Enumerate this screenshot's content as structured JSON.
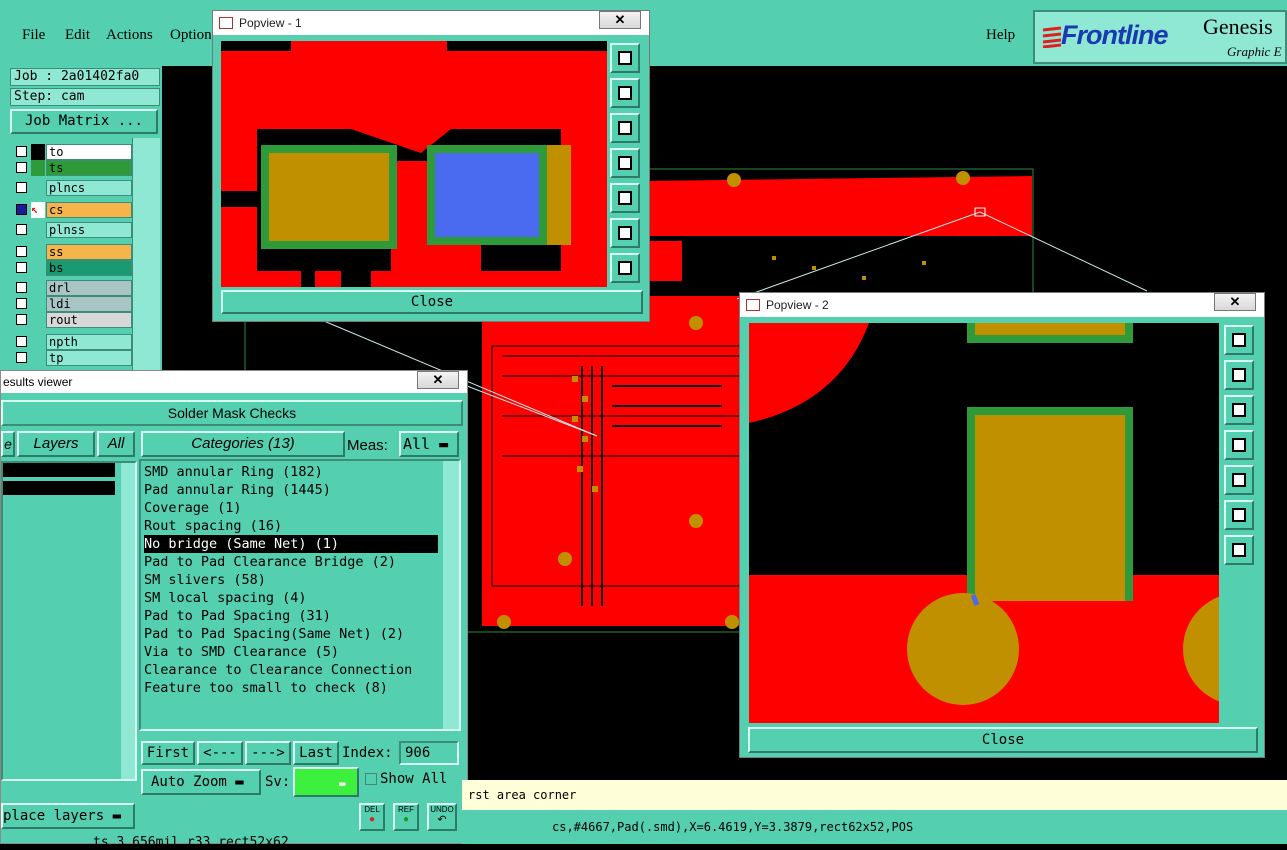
{
  "menubar": {
    "items": [
      {
        "label": "File"
      },
      {
        "label": "Edit"
      },
      {
        "label": "Actions"
      },
      {
        "label": "Option"
      }
    ],
    "help": "Help",
    "logo_brand": "Frontline",
    "logo_product": "Genesis",
    "logo_sub": "Graphic E"
  },
  "left": {
    "job": "Job : 2a01402fa0",
    "step": "Step: cam",
    "job_matrix": "Job Matrix ...",
    "layers": [
      {
        "name": "to",
        "color": "#ffffff",
        "swatch": "#000000"
      },
      {
        "name": "ts",
        "color": "#2e9a3a",
        "swatch": "#2e9a3a"
      },
      {
        "name": "plncs",
        "color": "#8fe8d4",
        "swatch": "#54cfb0"
      },
      {
        "name": "cs",
        "color": "#f6b44a",
        "swatch": "#e63a2a",
        "active": true
      },
      {
        "name": "plnss",
        "color": "#8fe8d4",
        "swatch": "#54cfb0"
      },
      {
        "name": "ss",
        "color": "#f6b44a",
        "swatch": "#54cfb0"
      },
      {
        "name": "bs",
        "color": "#1a9a70",
        "swatch": "#54cfb0"
      },
      {
        "name": "drl",
        "color": "#a8c4c4",
        "swatch": "#54cfb0"
      },
      {
        "name": "ldi",
        "color": "#a8c4c4",
        "swatch": "#54cfb0"
      },
      {
        "name": "rout",
        "color": "#d8d8d8",
        "swatch": "#54cfb0"
      },
      {
        "name": "npth",
        "color": "#8fe8d4",
        "swatch": "#54cfb0"
      },
      {
        "name": "tp",
        "color": "#8fe8d4",
        "swatch": "#54cfb0"
      }
    ]
  },
  "results": {
    "window_title": "esults viewer",
    "header": "Solder Mask Checks",
    "tab_e": "e",
    "layers_label": "Layers",
    "all_label": "All",
    "categories_label": "Categories (13)",
    "meas_label": "Meas:",
    "meas_value": "All",
    "categories": [
      "SMD annular Ring (182)",
      "Pad annular Ring (1445)",
      "Coverage (1)",
      "Rout spacing (16)",
      "No bridge (Same Net) (1)",
      "Pad to Pad Clearance Bridge (2)",
      "SM slivers (58)",
      "SM local spacing (4)",
      "Pad to Pad Spacing (31)",
      "Pad to Pad Spacing(Same Net) (2)",
      "Via to SMD Clearance (5)",
      "Clearance to Clearance Connection",
      "Feature too small to check (8)"
    ],
    "selected_index": 4,
    "nav": {
      "first": "First",
      "prev": "<---",
      "next": "--->",
      "last": "Last",
      "index_label": "Index:",
      "index_value": "906"
    },
    "auto_zoom": "Auto Zoom",
    "sv_label": "Sv:",
    "show_all": "Show All",
    "replace_layers": "place layers",
    "del": "DEL",
    "ref": "REF",
    "undo": "UNDO",
    "bottom_text": "ts 3.656mil  r33  rect52x62"
  },
  "popview1": {
    "title": "Popview - 1",
    "close": "Close"
  },
  "popview2": {
    "title": "Popview - 2",
    "close": "Close"
  },
  "prompt": "rst area corner",
  "status": "cs,#4667,Pad(.smd),X=6.4619,Y=3.3879,rect62x52,POS",
  "colors": {
    "teal": "#54cfb0",
    "copper": "#ff0000",
    "pad": "#c09000",
    "mask": "#2e9a3a",
    "blue": "#4a6af0"
  }
}
